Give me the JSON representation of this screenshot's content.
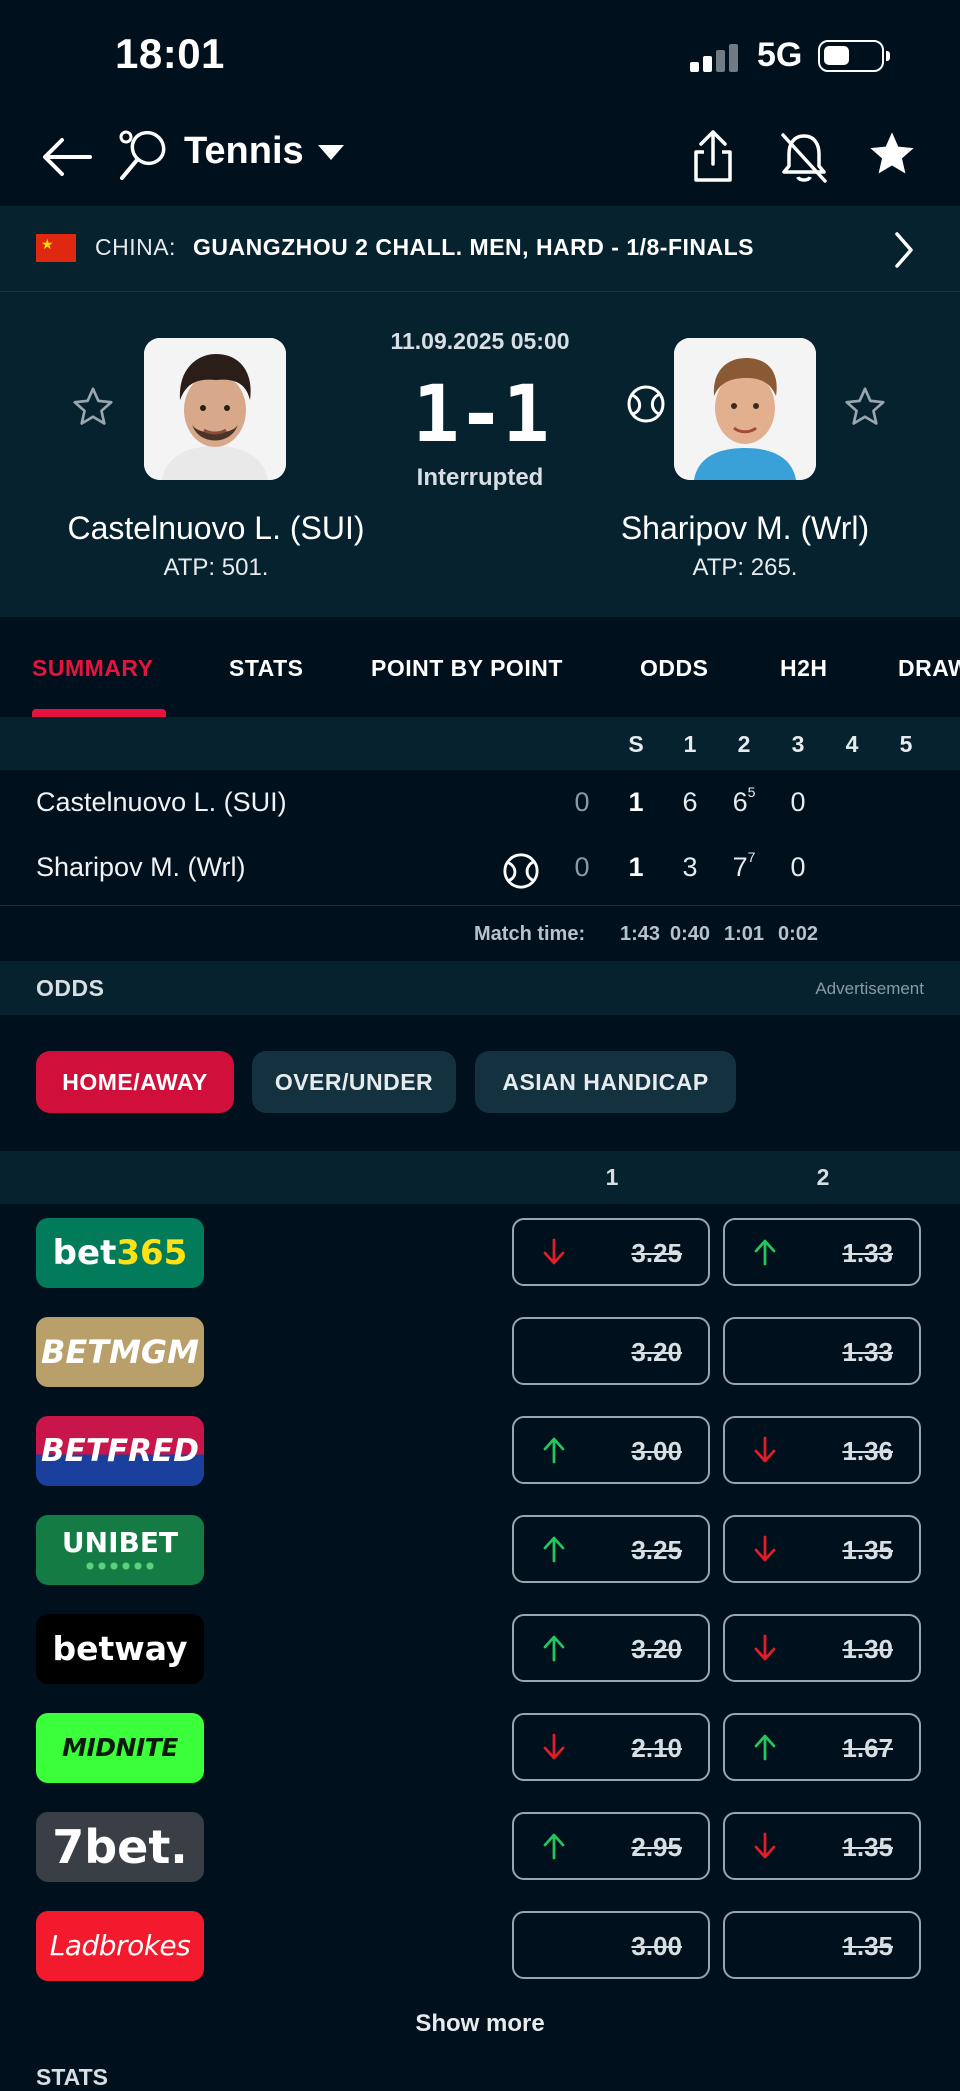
{
  "status_bar": {
    "time": "18:01",
    "network": "5G"
  },
  "header": {
    "title": "Tennis"
  },
  "league": {
    "country": "CHINA:",
    "name": "GUANGZHOU 2 CHALL. MEN, HARD - 1/8-FINALS"
  },
  "match": {
    "datetime": "11.09.2025 05:00",
    "score": "1-1",
    "status": "Interrupted",
    "home": {
      "name": "Castelnuovo L. (SUI)",
      "rank": "ATP: 501."
    },
    "away": {
      "name": "Sharipov M. (Wrl)",
      "rank": "ATP: 265."
    }
  },
  "tabs": [
    "SUMMARY",
    "STATS",
    "POINT BY POINT",
    "ODDS",
    "H2H",
    "DRAW"
  ],
  "scoreboard": {
    "headers": [
      "S",
      "1",
      "2",
      "3",
      "4",
      "5"
    ],
    "rows": [
      {
        "name": "Castelnuovo L. (SUI)",
        "points": "0",
        "sets": "1",
        "s1": "6",
        "s2": "6",
        "s2_tb": "5",
        "s3": "0"
      },
      {
        "name": "Sharipov M. (Wrl)",
        "points": "0",
        "sets": "1",
        "s1": "3",
        "s2": "7",
        "s2_tb": "7",
        "s3": "0"
      }
    ],
    "match_time_label": "Match time:",
    "match_times": [
      "1:43",
      "0:40",
      "1:01",
      "0:02"
    ]
  },
  "odds": {
    "title": "ODDS",
    "advertisement": "Advertisement",
    "filters": [
      "HOME/AWAY",
      "OVER/UNDER",
      "ASIAN HANDICAP"
    ],
    "col_home": "1",
    "col_away": "2",
    "bookmakers": [
      {
        "name": "bet365",
        "home": "3.25",
        "home_trend": "down",
        "away": "1.33",
        "away_trend": "up"
      },
      {
        "name": "BETMGM",
        "home": "3.20",
        "home_trend": "none",
        "away": "1.33",
        "away_trend": "none"
      },
      {
        "name": "BETFRED",
        "home": "3.00",
        "home_trend": "up",
        "away": "1.36",
        "away_trend": "down"
      },
      {
        "name": "UNIBET",
        "home": "3.25",
        "home_trend": "up",
        "away": "1.35",
        "away_trend": "down"
      },
      {
        "name": "betway",
        "home": "3.20",
        "home_trend": "up",
        "away": "1.30",
        "away_trend": "down"
      },
      {
        "name": "MIDNITE",
        "home": "2.10",
        "home_trend": "down",
        "away": "1.67",
        "away_trend": "up"
      },
      {
        "name": "7bet.",
        "home": "2.95",
        "home_trend": "up",
        "away": "1.35",
        "away_trend": "down"
      },
      {
        "name": "Ladbrokes",
        "home": "3.00",
        "home_trend": "none",
        "away": "1.35",
        "away_trend": "none"
      }
    ],
    "show_more": "Show more"
  },
  "next_section": "STATS",
  "colors": {
    "accent": "#e6143c",
    "up": "#22c55e",
    "down": "#e11d2a",
    "background": "#00101d",
    "panel": "#07222f"
  }
}
